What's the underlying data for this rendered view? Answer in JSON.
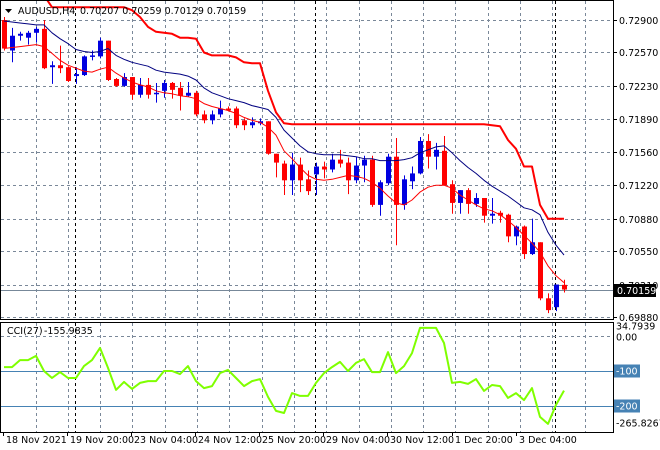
{
  "header": {
    "symbol": "AUDUSD,H4",
    "ohlc": "0.70207 0.70259 0.70129 0.70159"
  },
  "cci_header": {
    "label": "CCI(27)",
    "value": "-155.9835"
  },
  "colors": {
    "bull": "#0000e0",
    "bear": "#ff0000",
    "ma_blue": "#000080",
    "ma_red": "#ff0000",
    "cci": "#7fff00",
    "level": "#4682b4",
    "grid": "#7a8899"
  },
  "chart_data": [
    {
      "type": "candlestick",
      "title": "AUDUSD,H4",
      "ylim": [
        0.6988,
        0.729
      ],
      "y_ticks": [
        "0.72900",
        "0.72570",
        "0.72230",
        "0.71890",
        "0.71560",
        "0.71220",
        "0.70880",
        "0.70550",
        "0.70210",
        "0.69880"
      ],
      "current_price": "0.70159",
      "x_ticks": [
        "18 Nov 2021",
        "19 Nov 20:00",
        "23 Nov 04:00",
        "24 Nov 12:00",
        "25 Nov 20:00",
        "29 Nov 04:00",
        "30 Nov 12:00",
        "1 Dec 20:00",
        "3 Dec 04:00"
      ],
      "candles_ohlc": [
        [
          0.729,
          0.7293,
          0.7259,
          0.7261
        ],
        [
          0.7259,
          0.7282,
          0.7247,
          0.7274
        ],
        [
          0.7274,
          0.7278,
          0.7269,
          0.7276
        ],
        [
          0.7272,
          0.7279,
          0.7265,
          0.7277
        ],
        [
          0.7277,
          0.7283,
          0.7267,
          0.7281
        ],
        [
          0.7281,
          0.729,
          0.724,
          0.7241
        ],
        [
          0.7242,
          0.7248,
          0.7225,
          0.7244
        ],
        [
          0.7244,
          0.7264,
          0.7236,
          0.7241
        ],
        [
          0.7242,
          0.7243,
          0.7227,
          0.7228
        ],
        [
          0.7233,
          0.7242,
          0.7225,
          0.7235
        ],
        [
          0.7234,
          0.7254,
          0.7233,
          0.7253
        ],
        [
          0.7253,
          0.7259,
          0.7249,
          0.7254
        ],
        [
          0.7253,
          0.7272,
          0.7251,
          0.7269
        ],
        [
          0.7269,
          0.7269,
          0.7228,
          0.7229
        ],
        [
          0.723,
          0.7231,
          0.7222,
          0.7223
        ],
        [
          0.7223,
          0.7236,
          0.7222,
          0.7232
        ],
        [
          0.7232,
          0.7232,
          0.7209,
          0.7214
        ],
        [
          0.7214,
          0.7231,
          0.7211,
          0.7224
        ],
        [
          0.7224,
          0.7231,
          0.721,
          0.7214
        ],
        [
          0.7215,
          0.7226,
          0.7206,
          0.7216
        ],
        [
          0.7218,
          0.7229,
          0.7211,
          0.7226
        ],
        [
          0.7226,
          0.7227,
          0.721,
          0.7219
        ],
        [
          0.7221,
          0.7227,
          0.7198,
          0.7213
        ],
        [
          0.7213,
          0.7227,
          0.7212,
          0.7216
        ],
        [
          0.7216,
          0.7218,
          0.7192,
          0.7194
        ],
        [
          0.7194,
          0.7198,
          0.7185,
          0.7188
        ],
        [
          0.7188,
          0.7198,
          0.7184,
          0.7194
        ],
        [
          0.7194,
          0.7208,
          0.7191,
          0.72
        ],
        [
          0.72,
          0.7202,
          0.7197,
          0.7198
        ],
        [
          0.72,
          0.7202,
          0.718,
          0.7183
        ],
        [
          0.7188,
          0.719,
          0.7178,
          0.7183
        ],
        [
          0.7183,
          0.7191,
          0.718,
          0.7186
        ],
        [
          0.7185,
          0.719,
          0.7183,
          0.7187
        ],
        [
          0.7187,
          0.7187,
          0.7153,
          0.7154
        ],
        [
          0.7154,
          0.7154,
          0.713,
          0.7145
        ],
        [
          0.7144,
          0.7147,
          0.7112,
          0.7127
        ],
        [
          0.7127,
          0.7155,
          0.7112,
          0.7143
        ],
        [
          0.7143,
          0.715,
          0.7115,
          0.7127
        ],
        [
          0.7128,
          0.7137,
          0.7112,
          0.7116
        ],
        [
          0.7133,
          0.7145,
          0.7112,
          0.7141
        ],
        [
          0.7141,
          0.7146,
          0.7129,
          0.7138
        ],
        [
          0.7138,
          0.7154,
          0.7135,
          0.7148
        ],
        [
          0.7148,
          0.7158,
          0.714,
          0.7144
        ],
        [
          0.7145,
          0.715,
          0.7113,
          0.7127
        ],
        [
          0.7127,
          0.7151,
          0.7124,
          0.7142
        ],
        [
          0.7142,
          0.7152,
          0.7125,
          0.7148
        ],
        [
          0.7148,
          0.7152,
          0.71,
          0.7102
        ],
        [
          0.7102,
          0.7127,
          0.7091,
          0.7125
        ],
        [
          0.7124,
          0.7154,
          0.7122,
          0.7151
        ],
        [
          0.7151,
          0.717,
          0.7061,
          0.7102
        ],
        [
          0.7102,
          0.7132,
          0.7097,
          0.7128
        ],
        [
          0.7126,
          0.7141,
          0.7118,
          0.7134
        ],
        [
          0.7134,
          0.7171,
          0.7133,
          0.7167
        ],
        [
          0.7167,
          0.7174,
          0.7139,
          0.7151
        ],
        [
          0.7151,
          0.7165,
          0.7138,
          0.7158
        ],
        [
          0.7157,
          0.7172,
          0.7122,
          0.7122
        ],
        [
          0.7123,
          0.7127,
          0.7093,
          0.7104
        ],
        [
          0.7104,
          0.7117,
          0.7093,
          0.7117
        ],
        [
          0.7117,
          0.7119,
          0.7093,
          0.7103
        ],
        [
          0.7103,
          0.7114,
          0.71,
          0.7109
        ],
        [
          0.7109,
          0.7109,
          0.7084,
          0.7091
        ],
        [
          0.7091,
          0.7109,
          0.7083,
          0.7093
        ],
        [
          0.7094,
          0.7096,
          0.7084,
          0.7091
        ],
        [
          0.7092,
          0.7093,
          0.7064,
          0.707
        ],
        [
          0.707,
          0.7081,
          0.7061,
          0.708
        ],
        [
          0.708,
          0.7081,
          0.7047,
          0.7052
        ],
        [
          0.7052,
          0.7088,
          0.7051,
          0.7064
        ],
        [
          0.7064,
          0.7064,
          0.7005,
          0.7007
        ],
        [
          0.7007,
          0.7012,
          0.6992,
          0.6995
        ],
        [
          0.6998,
          0.7021,
          0.6994,
          0.7021
        ],
        [
          0.70207,
          0.70259,
          0.70129,
          0.70159
        ]
      ],
      "series": [
        {
          "name": "MA blue",
          "values": [
            0.7289,
            0.7288,
            0.7287,
            0.7286,
            0.7285,
            0.7285,
            0.7277,
            0.7271,
            0.7266,
            0.726,
            0.7258,
            0.7257,
            0.7258,
            0.7261,
            0.7254,
            0.725,
            0.7247,
            0.7245,
            0.7243,
            0.7239,
            0.7237,
            0.7236,
            0.7235,
            0.7233,
            0.7229,
            0.7221,
            0.7216,
            0.7213,
            0.721,
            0.7208,
            0.7206,
            0.7203,
            0.7201,
            0.7199,
            0.7191,
            0.7178,
            0.717,
            0.7162,
            0.7156,
            0.7154,
            0.7153,
            0.7153,
            0.7153,
            0.7152,
            0.7151,
            0.7149,
            0.7149,
            0.7147,
            0.7147,
            0.7147,
            0.7148,
            0.715,
            0.7155,
            0.7158,
            0.7161,
            0.7162,
            0.7155,
            0.7147,
            0.714,
            0.7134,
            0.7127,
            0.7121,
            0.7116,
            0.7111,
            0.7105,
            0.7099,
            0.7097,
            0.7092,
            0.7074,
            0.7061,
            0.7051
          ]
        },
        {
          "name": "MA red",
          "values": [
            0.7261,
            0.7262,
            0.7263,
            0.7264,
            0.7265,
            0.7263,
            0.7256,
            0.7249,
            0.7244,
            0.7241,
            0.7238,
            0.7237,
            0.724,
            0.7242,
            0.7236,
            0.7231,
            0.7227,
            0.7224,
            0.7222,
            0.7218,
            0.7216,
            0.7215,
            0.7213,
            0.7212,
            0.721,
            0.7205,
            0.7202,
            0.72,
            0.7198,
            0.7195,
            0.7191,
            0.7188,
            0.7186,
            0.7181,
            0.7173,
            0.7157,
            0.7149,
            0.714,
            0.7132,
            0.7128,
            0.7127,
            0.7128,
            0.713,
            0.7132,
            0.7131,
            0.7129,
            0.7125,
            0.7119,
            0.7111,
            0.7104,
            0.7102,
            0.7107,
            0.7115,
            0.712,
            0.7122,
            0.7122,
            0.7119,
            0.7112,
            0.7107,
            0.7102,
            0.7098,
            0.7096,
            0.7092,
            0.7086,
            0.7079,
            0.7071,
            0.7063,
            0.7054,
            0.704,
            0.703,
            0.7023
          ]
        },
        {
          "name": "Upper band",
          "values": [
            null,
            null,
            null,
            null,
            null,
            0.7315,
            0.7303,
            0.7303,
            0.7303,
            0.7303,
            0.7303,
            0.7303,
            0.7303,
            0.7303,
            0.7303,
            0.7303,
            0.73,
            0.7293,
            0.7283,
            0.7278,
            0.7277,
            0.7276,
            0.7272,
            0.7272,
            0.7271,
            0.7257,
            0.7254,
            0.7254,
            0.7254,
            0.7252,
            0.7247,
            0.7246,
            0.7246,
            0.7218,
            0.7196,
            0.7185,
            0.7184,
            0.7184,
            0.7184,
            0.7184,
            0.7184,
            0.7184,
            0.7184,
            0.7184,
            0.7184,
            0.7184,
            0.7184,
            0.7184,
            0.7184,
            0.7184,
            0.7184,
            0.7184,
            0.7184,
            0.7184,
            0.7184,
            0.7184,
            0.7184,
            0.7184,
            0.7184,
            0.7184,
            0.7184,
            0.7183,
            0.7182,
            0.7168,
            0.7159,
            0.7141,
            0.7141,
            0.7102,
            0.7088,
            0.7088,
            0.7088
          ]
        }
      ]
    },
    {
      "type": "line",
      "title": "CCI(27)",
      "ylim": [
        -265.8267,
        34.7939
      ],
      "y_ticks": [
        "34.7939",
        "0.00",
        "-100",
        "-200",
        "-265.8267"
      ],
      "levels": [
        0,
        -100,
        -200
      ],
      "values": [
        -89,
        -89,
        -69,
        -69,
        -57,
        -100,
        -120,
        -103,
        -120,
        -120,
        -86,
        -69,
        -34,
        -91,
        -154,
        -131,
        -151,
        -134,
        -129,
        -129,
        -100,
        -100,
        -109,
        -86,
        -129,
        -149,
        -143,
        -106,
        -97,
        -120,
        -143,
        -129,
        -123,
        -174,
        -214,
        -220,
        -163,
        -171,
        -171,
        -134,
        -106,
        -89,
        -74,
        -100,
        -77,
        -66,
        -103,
        -103,
        -46,
        -106,
        -86,
        -49,
        23,
        23,
        23,
        -20,
        -134,
        -131,
        -137,
        -123,
        -157,
        -140,
        -143,
        -177,
        -163,
        -183,
        -149,
        -231,
        -251,
        -197,
        -155.9835
      ]
    }
  ]
}
